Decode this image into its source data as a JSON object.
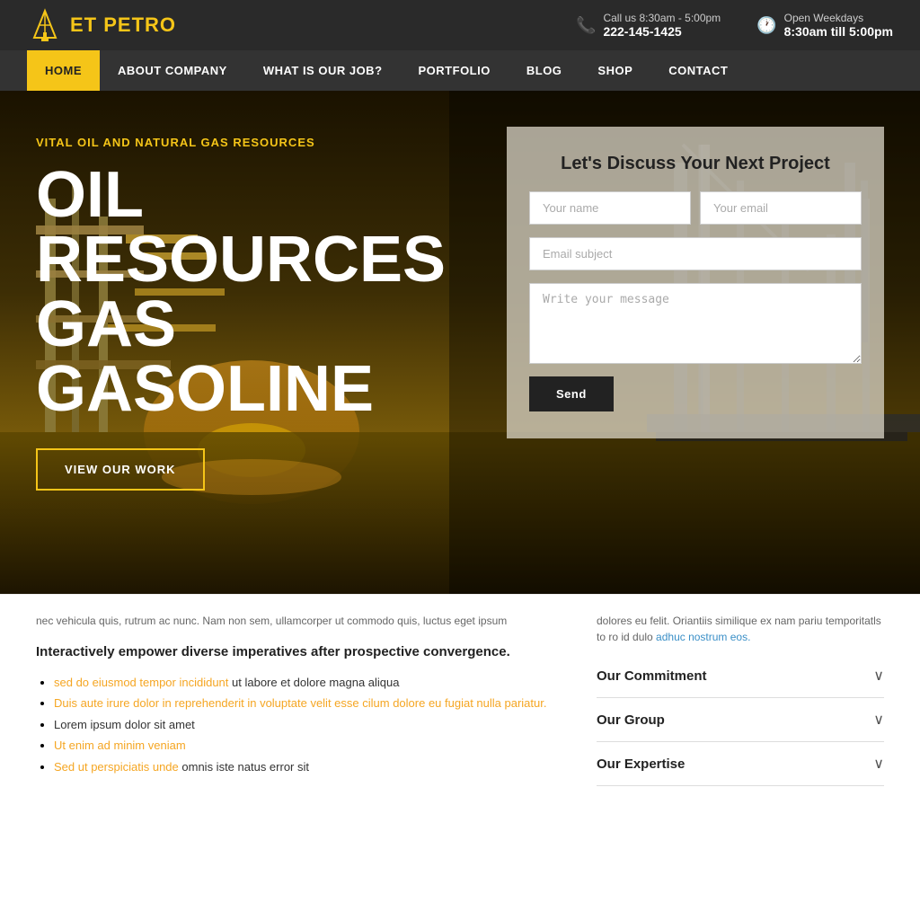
{
  "topbar": {
    "logo_et": "ET",
    "logo_petro": "PETRO",
    "phone_label": "Call us 8:30am - 5:00pm",
    "phone_number": "222-145-1425",
    "hours_label": "Open Weekdays",
    "hours_value": "8:30am till 5:00pm"
  },
  "nav": {
    "items": [
      {
        "label": "HOME",
        "active": true
      },
      {
        "label": "ABOUT COMPANY",
        "active": false
      },
      {
        "label": "WHAT IS OUR JOB?",
        "active": false
      },
      {
        "label": "PORTFOLIO",
        "active": false
      },
      {
        "label": "BLOG",
        "active": false
      },
      {
        "label": "SHOP",
        "active": false
      },
      {
        "label": "CONTACT",
        "active": false
      }
    ]
  },
  "hero": {
    "subtitle": "VITAL OIL AND NATURAL GAS RESOURCES",
    "title_line1": "OIL",
    "title_line2": "RESOURCES",
    "title_line3": "GAS",
    "title_line4": "GASOLINE",
    "cta_label": "VIEW OUR WORK"
  },
  "contact_form": {
    "title": "Let's Discuss Your Next Project",
    "name_placeholder": "Your name",
    "email_placeholder": "Your email",
    "subject_placeholder": "Email subject",
    "message_placeholder": "Write your message",
    "send_label": "Send"
  },
  "bottom": {
    "lorem_left": "nec vehicula quis, rutrum ac nunc. Nam non sem, ullamcorper ut commodo quis, luctus eget ipsum",
    "empowerment": "Interactively empower diverse imperatives after prospective convergence.",
    "bullets": [
      {
        "text": "sed do eiusmod tempor incididunt ut labore et dolore magna aliqua",
        "link_part": "sed do eiusmod tempor incididunt"
      },
      {
        "text": "Duis aute irure dolor in reprehenderit in voluptate velit esse cilum dolore eu fugiat nulla pariatur.",
        "link_part": "Duis aute irure dolor in reprehenderit in voluptate velit esse cilum dolore eu fugiat nulla pariatur."
      },
      {
        "text": "Lorem ipsum dolor sit amet",
        "link_part": ""
      },
      {
        "text": "Ut enim ad minim veniam",
        "link_part": "Ut enim ad minim veniam"
      },
      {
        "text": "Sed ut perspiciatis unde omnis iste natus error sit",
        "link_part": "Sed ut perspiciatis unde"
      }
    ],
    "lorem_right": "dolores eu felit. Oriantiis similique ex nam pariu temporitatls to ro id dulo adhuc nostrum eos.",
    "right_link": "adhuc nostrum eos.",
    "accordions": [
      {
        "label": "Our Commitment"
      },
      {
        "label": "Our Group"
      },
      {
        "label": "Our Expertise"
      }
    ]
  }
}
